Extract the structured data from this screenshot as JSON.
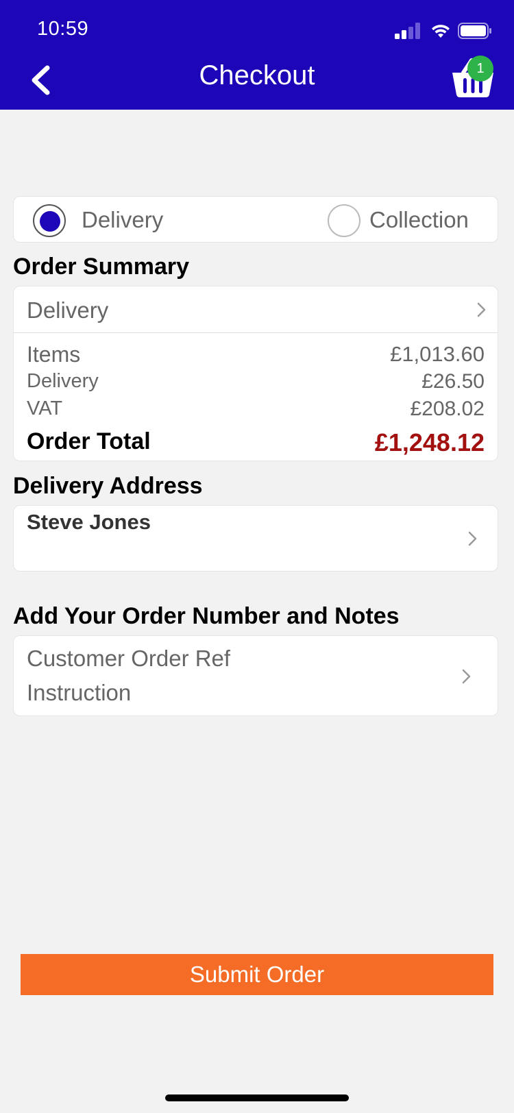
{
  "status_bar": {
    "time": "10:59"
  },
  "header": {
    "title": "Checkout",
    "basket_count": "1"
  },
  "fulfilment": {
    "options": [
      {
        "label": "Delivery",
        "selected": true
      },
      {
        "label": "Collection",
        "selected": false
      }
    ]
  },
  "order_summary": {
    "title": "Order Summary",
    "method_label": "Delivery",
    "lines": [
      {
        "label": "Items",
        "value": "£1,013.60"
      },
      {
        "label": "Delivery",
        "value": "£26.50"
      },
      {
        "label": "VAT",
        "value": "£208.02"
      }
    ],
    "total_label": "Order Total",
    "total_value": "£1,248.12"
  },
  "delivery_address": {
    "title": "Delivery Address",
    "name": "Steve Jones"
  },
  "notes": {
    "title": "Add Your Order Number and Notes",
    "customer_ref_label": "Customer Order Ref",
    "instruction_label": "Instruction"
  },
  "submit_label": "Submit Order",
  "colors": {
    "header": "#1c06b8",
    "accent_button": "#f46c25",
    "total_red": "#a31010",
    "badge_green": "#2eb34a"
  }
}
